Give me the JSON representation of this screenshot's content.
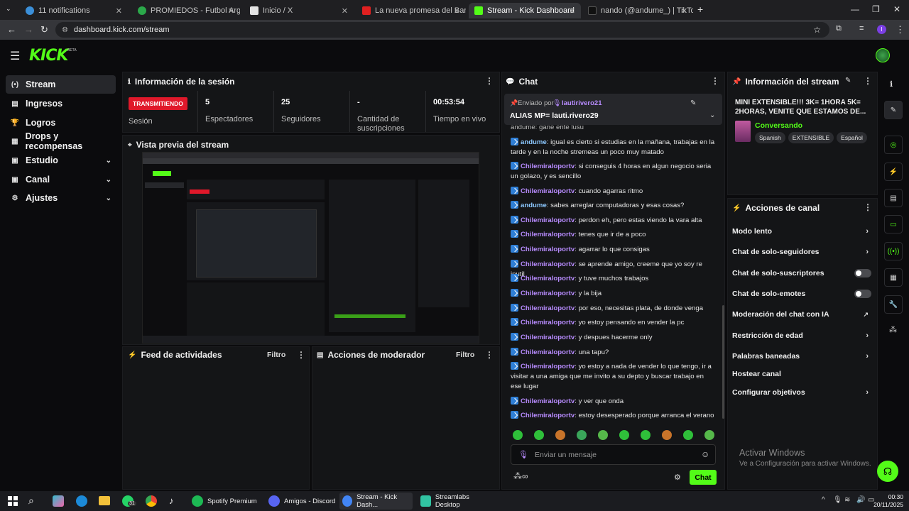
{
  "browser": {
    "tabs": [
      {
        "label": "11 notifications",
        "color": "#3b8fd8"
      },
      {
        "label": "PROMIEDOS - Futbol Argentina",
        "color": "#2ba84a"
      },
      {
        "label": "Inicio / X",
        "color": "#e5e5e5"
      },
      {
        "label": "La nueva promesa del Barça no",
        "color": "#e02020"
      },
      {
        "label": "Stream - Kick Dashboard",
        "color": "#53fc18"
      },
      {
        "label": "nando (@andume_) | TikTok",
        "color": "#111111"
      }
    ],
    "url": "dashboard.kick.com/stream"
  },
  "header": {
    "logo": "KICK",
    "beta": "BETA"
  },
  "sidebar": {
    "items": [
      {
        "label": "Stream",
        "icon": "(•)"
      },
      {
        "label": "Ingresos",
        "icon": "▤"
      },
      {
        "label": "Logros",
        "icon": "🏆"
      },
      {
        "label": "Drops y recompensas",
        "icon": "▦"
      },
      {
        "label": "Estudio",
        "icon": "▣"
      },
      {
        "label": "Canal",
        "icon": "▣"
      },
      {
        "label": "Ajustes",
        "icon": "⚙"
      }
    ]
  },
  "session": {
    "title": "Información de la sesión",
    "live_badge": "TRANSMITIENDO",
    "session_label": "Sesión",
    "stats": [
      {
        "value": "5",
        "label": "Espectadores"
      },
      {
        "value": "25",
        "label": "Seguidores"
      },
      {
        "value": "-",
        "label": "Cantidad de suscripciones"
      },
      {
        "value": "00:53:54",
        "label": "Tiempo en vivo"
      }
    ]
  },
  "preview": {
    "title": "Vista previa del stream"
  },
  "activity": {
    "title": "Feed de actividades",
    "filter": "Filtro"
  },
  "moderator": {
    "title": "Acciones de moderador",
    "filter": "Filtro"
  },
  "chat": {
    "title": "Chat",
    "pinned_prefix": "Enviado por",
    "pinned_user": "lautirivero21",
    "pinned_text": "ALIAS MP= lauti.rivero29",
    "partial_top": "andume: gane ente lusu",
    "messages": [
      {
        "user": "andume",
        "text": ": igual es cierto si estudias en la mañana, trabajas en la tarde y en la noche stremeas un poco muy matado",
        "cls": "u2"
      },
      {
        "user": "Chilemiraloportv",
        "text": ": si conseguis 4 horas en algun negocio seria un golazo, y es sencillo",
        "cls": "u1"
      },
      {
        "user": "Chilemiraloportv",
        "text": ": cuando agarras ritmo",
        "cls": "u1"
      },
      {
        "user": "andume",
        "text": ": sabes arreglar computadoras y esas cosas?",
        "cls": "u2"
      },
      {
        "user": "Chilemiraloportv",
        "text": ": perdon eh, pero estas viendo la vara alta",
        "cls": "u1"
      },
      {
        "user": "Chilemiraloportv",
        "text": ": tenes que ir de a poco",
        "cls": "u1"
      },
      {
        "user": "Chilemiraloportv",
        "text": ": agarrar lo que consigas",
        "cls": "u1"
      },
      {
        "user": "Chilemiraloportv",
        "text": ": se aprende amigo, creeme que yo soy re inutil",
        "cls": "u1"
      },
      {
        "user": "Chilemiraloportv",
        "text": ": y tuve muchos trabajos",
        "cls": "u1"
      },
      {
        "user": "Chilemiraloportv",
        "text": ": y la bija",
        "cls": "u1"
      },
      {
        "user": "Chilemiraloportv",
        "text": ": por eso, necesitas plata, de donde venga",
        "cls": "u1"
      },
      {
        "user": "Chilemiraloportv",
        "text": ": yo estoy pensando en vender la pc",
        "cls": "u1"
      },
      {
        "user": "Chilemiraloportv",
        "text": ": y despues hacerme only",
        "cls": "u1"
      },
      {
        "user": "Chilemiraloportv",
        "text": ": una tapu?",
        "cls": "u1"
      },
      {
        "user": "Chilemiraloportv",
        "text": ": yo estoy a nada de vender lo que tengo, ir a visitar a una amiga que me invito a su depto y buscar trabajo en ese lugar",
        "cls": "u1"
      },
      {
        "user": "Chilemiraloportv",
        "text": ": y ver que onda",
        "cls": "u1"
      },
      {
        "user": "Chilemiraloportv",
        "text": ": estoy desesperado porque arranca el verano",
        "cls": "u1"
      }
    ],
    "input_placeholder": "Enviar un mensaje",
    "send_label": "Chat"
  },
  "stream_info": {
    "title": "Información del stream",
    "stream_title": "MINI EXTENSIBLE!!! 3K= 1HORA 5K= 2HORAS, VENITE QUE ESTAMOS DE...",
    "category": "Conversando",
    "tags": [
      "Spanish",
      "EXTENSIBLE",
      "Español"
    ]
  },
  "channel_actions": {
    "title": "Acciones de canal",
    "items": [
      {
        "label": "Modo lento",
        "type": "chevron"
      },
      {
        "label": "Chat de solo-seguidores",
        "type": "chevron"
      },
      {
        "label": "Chat de solo-suscriptores",
        "type": "toggle"
      },
      {
        "label": "Chat de solo-emotes",
        "type": "toggle"
      },
      {
        "label": "Moderación del chat con IA",
        "type": "external"
      },
      {
        "label": "Restricción de edad",
        "type": "chevron"
      },
      {
        "label": "Palabras baneadas",
        "type": "chevron"
      },
      {
        "label": "Hostear canal",
        "type": "none"
      },
      {
        "label": "Configurar objetivos",
        "type": "chevron"
      }
    ]
  },
  "windows": {
    "activate_title": "Activar Windows",
    "activate_sub": "Ve a Configuración para activar Windows."
  },
  "taskbar": {
    "apps": [
      {
        "label": "Spotify Premium",
        "color": "#1db954"
      },
      {
        "label": "Amigos - Discord",
        "color": "#5865f2"
      },
      {
        "label": "Stream - Kick Dash...",
        "color": "#4285f4"
      },
      {
        "label": "Streamlabs Desktop",
        "color": "#31c3a2"
      }
    ],
    "whatsapp_badge": "31",
    "time": "00:30",
    "date": "20/11/2025"
  }
}
